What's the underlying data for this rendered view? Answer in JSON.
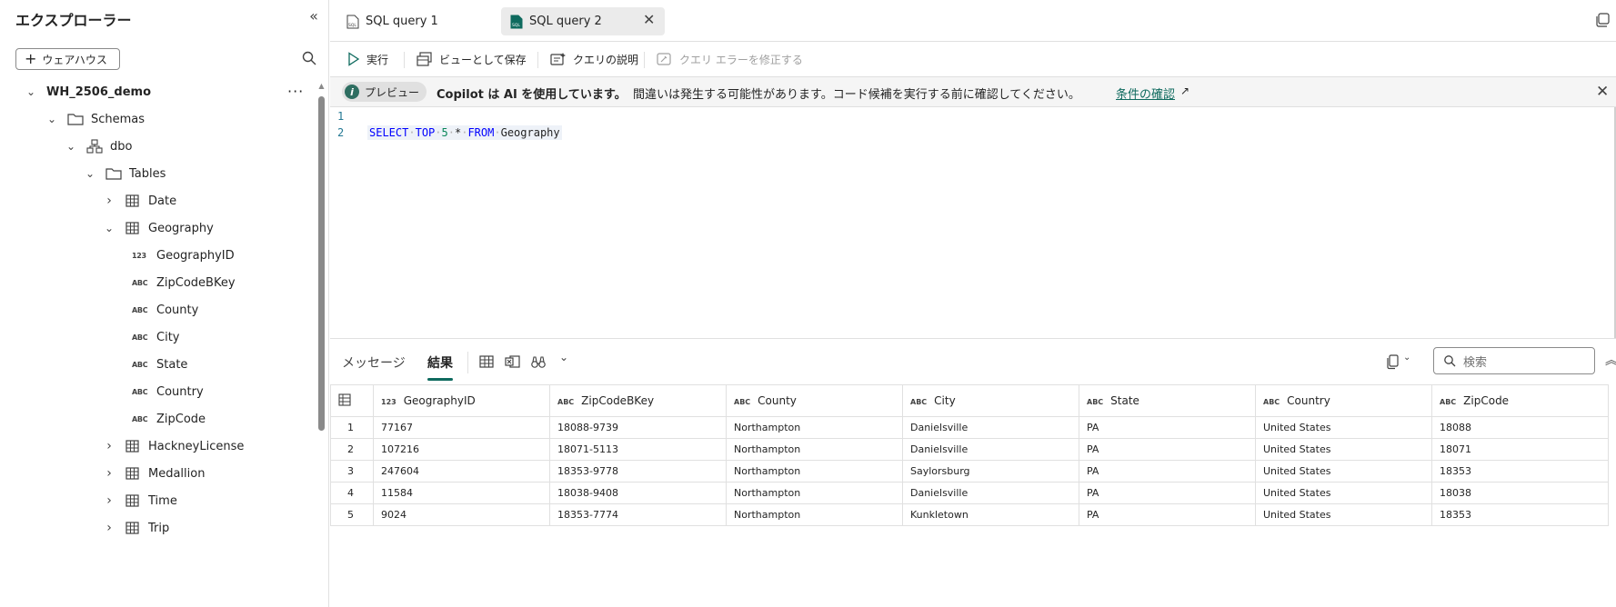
{
  "sidebar": {
    "title": "エクスプローラー",
    "add_warehouse_label": "ウェアハウス",
    "tree": [
      {
        "label": "WH_2506_demo",
        "level": 0,
        "type": "warehouse",
        "expanded": true,
        "more": "···"
      },
      {
        "label": "Schemas",
        "level": 1,
        "type": "folder",
        "expanded": true
      },
      {
        "label": "dbo",
        "level": 2,
        "type": "schema",
        "expanded": true
      },
      {
        "label": "Tables",
        "level": 3,
        "type": "folder",
        "expanded": true
      },
      {
        "label": "Date",
        "level": 4,
        "type": "table",
        "expanded": false
      },
      {
        "label": "Geography",
        "level": 4,
        "type": "table",
        "expanded": true
      },
      {
        "label": "GeographyID",
        "level": 5,
        "type": "column",
        "badge": "123"
      },
      {
        "label": "ZipCodeBKey",
        "level": 5,
        "type": "column",
        "badge": "ABC"
      },
      {
        "label": "County",
        "level": 5,
        "type": "column",
        "badge": "ABC"
      },
      {
        "label": "City",
        "level": 5,
        "type": "column",
        "badge": "ABC"
      },
      {
        "label": "State",
        "level": 5,
        "type": "column",
        "badge": "ABC"
      },
      {
        "label": "Country",
        "level": 5,
        "type": "column",
        "badge": "ABC"
      },
      {
        "label": "ZipCode",
        "level": 5,
        "type": "column",
        "badge": "ABC"
      },
      {
        "label": "HackneyLicense",
        "level": 4,
        "type": "table",
        "expanded": false
      },
      {
        "label": "Medallion",
        "level": 4,
        "type": "table",
        "expanded": false
      },
      {
        "label": "Time",
        "level": 4,
        "type": "table",
        "expanded": false
      },
      {
        "label": "Trip",
        "level": 4,
        "type": "table",
        "expanded": false
      }
    ]
  },
  "tabs": [
    {
      "label": "SQL query 1",
      "active": false
    },
    {
      "label": "SQL query 2",
      "active": true
    }
  ],
  "toolbar": {
    "run_label": "実行",
    "save_as_view_label": "ビューとして保存",
    "explain_label": "クエリの説明",
    "fix_label": "クエリ エラーを修正する"
  },
  "banner": {
    "preview_label": "プレビュー",
    "bold_text": "Copilot は AI を使用しています。",
    "text": "間違いは発生する可能性があります。コード候補を実行する前に確認してください。",
    "link_text": "条件の確認"
  },
  "editor": {
    "line_numbers": [
      "1",
      "2"
    ],
    "tokens": {
      "kw1": "SELECT",
      "kw2": "TOP",
      "num": "5",
      "star": "*",
      "kw3": "FROM",
      "ident": "Geography"
    }
  },
  "results": {
    "tab_messages": "メッセージ",
    "tab_results": "結果",
    "search_placeholder": "検索",
    "columns": [
      {
        "name": "GeographyID",
        "badge": "123"
      },
      {
        "name": "ZipCodeBKey",
        "badge": "ABC"
      },
      {
        "name": "County",
        "badge": "ABC"
      },
      {
        "name": "City",
        "badge": "ABC"
      },
      {
        "name": "State",
        "badge": "ABC"
      },
      {
        "name": "Country",
        "badge": "ABC"
      },
      {
        "name": "ZipCode",
        "badge": "ABC"
      }
    ],
    "rows": [
      [
        "1",
        "77167",
        "18088-9739",
        "Northampton",
        "Danielsville",
        "PA",
        "United States",
        "18088"
      ],
      [
        "2",
        "107216",
        "18071-5113",
        "Northampton",
        "Danielsville",
        "PA",
        "United States",
        "18071"
      ],
      [
        "3",
        "247604",
        "18353-9778",
        "Northampton",
        "Saylorsburg",
        "PA",
        "United States",
        "18353"
      ],
      [
        "4",
        "11584",
        "18038-9408",
        "Northampton",
        "Danielsville",
        "PA",
        "United States",
        "18038"
      ],
      [
        "5",
        "9024",
        "18353-7774",
        "Northampton",
        "Kunkletown",
        "PA",
        "United States",
        "18353"
      ]
    ]
  }
}
